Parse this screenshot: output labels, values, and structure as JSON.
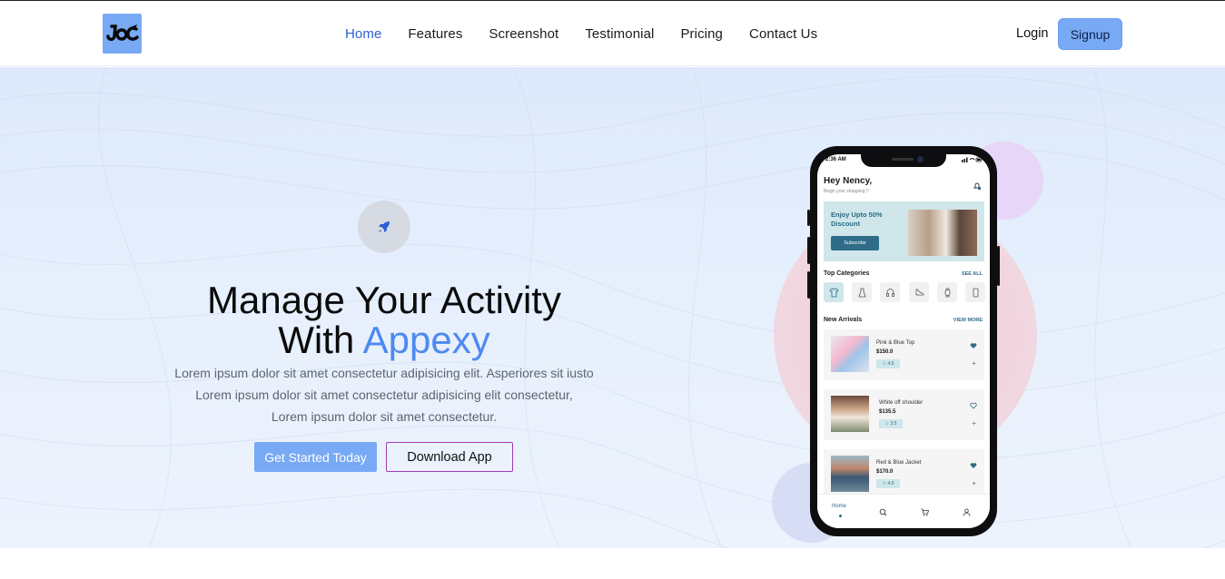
{
  "nav": {
    "logo_text": "JOE",
    "items": [
      {
        "label": "Home",
        "active": true
      },
      {
        "label": "Features",
        "active": false
      },
      {
        "label": "Screenshot",
        "active": false
      },
      {
        "label": "Testimonial",
        "active": false
      },
      {
        "label": "Pricing",
        "active": false
      },
      {
        "label": "Contact Us",
        "active": false
      }
    ],
    "login_label": "Login",
    "signup_label": "Signup"
  },
  "hero": {
    "icon": "rocket-icon",
    "title_line1": "Manage Your Activity",
    "title_line2_prefix": "With ",
    "title_line2_accent": "Appexy",
    "description_lines": [
      "Lorem ipsum dolor sit amet consectetur adipisicing elit. Asperiores sit iusto",
      "Lorem ipsum dolor sit amet consectetur adipisicing elit consectetur,",
      "Lorem ipsum dolor sit amet consectetur."
    ],
    "primary_button": "Get Started Today",
    "secondary_button": "Download App"
  },
  "phone": {
    "status_time": "2:36 AM",
    "greeting": "Hey Nency,",
    "greeting_sub": "Begin your shopping !!",
    "promo_title": "Enjoy Upto 50% Discount",
    "promo_button": "Subscribe",
    "categories_title": "Top Categories",
    "categories_link": "SEE ALL",
    "category_icons": [
      "shirt-icon",
      "dress-icon",
      "headphones-icon",
      "shoe-icon",
      "watch-icon",
      "phone-icon"
    ],
    "arrivals_title": "New Arrivals",
    "arrivals_link": "VIEW MORE",
    "products": [
      {
        "name": "Pink & Blue Top",
        "price": "$150.0",
        "rating": "☆ 4.5",
        "favorite": true
      },
      {
        "name": "White off shoulder",
        "price": "$135.5",
        "rating": "☆ 3.5",
        "favorite": false
      },
      {
        "name": "Red & Blue Jacket",
        "price": "$170.0",
        "rating": "☆ 4.0",
        "favorite": true
      }
    ],
    "tab_home": "Home",
    "tab_icons": [
      "search-icon",
      "cart-icon",
      "user-icon"
    ]
  },
  "colors": {
    "accent": "#4c8af0",
    "button": "#78a9f4",
    "outline": "#a23ab3",
    "app_teal": "#2f6c88"
  }
}
